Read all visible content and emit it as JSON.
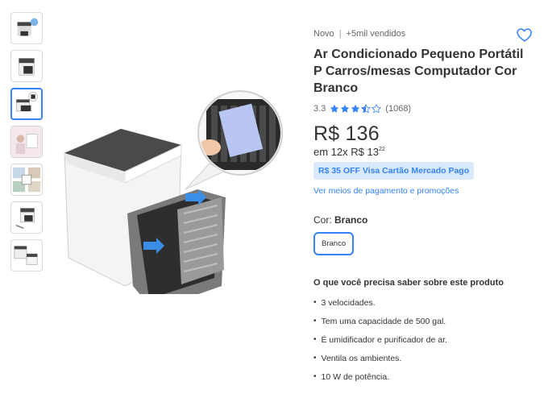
{
  "thumbnails": [
    {
      "name": "thumb-1"
    },
    {
      "name": "thumb-2"
    },
    {
      "name": "thumb-3"
    },
    {
      "name": "thumb-4"
    },
    {
      "name": "thumb-5"
    },
    {
      "name": "thumb-6"
    },
    {
      "name": "thumb-7"
    }
  ],
  "product": {
    "condition": "Novo",
    "separator": "|",
    "sold": "+5mil vendidos",
    "title": "Ar Condicionado Pequeno Portátil P Carros/mesas Computador Cor Branco",
    "rating_value": "3.3",
    "rating_stars": 3.5,
    "review_count": "(1068)",
    "price": "R$ 136",
    "installments_prefix": "em 12x R$ 13",
    "installments_cents": "22",
    "discount_badge": "R$ 35 OFF Visa Cartão Mercado Pago",
    "payment_link": "Ver meios de pagamento e promoções",
    "color_label": "Cor:",
    "color_value": "Branco",
    "color_option": "Branco",
    "know_title": "O que você precisa saber sobre este produto",
    "features": [
      "3 velocidades.",
      "Tem uma capacidade de 500 gal.",
      "É umidificador e purificador de ar.",
      "Ventila os ambientes.",
      " 10 W de potência."
    ]
  },
  "colors": {
    "accent": "#3483fa",
    "badge_bg": "#dbe9fc"
  },
  "icons": {
    "favorite": "heart-icon",
    "star": "star-icon"
  }
}
